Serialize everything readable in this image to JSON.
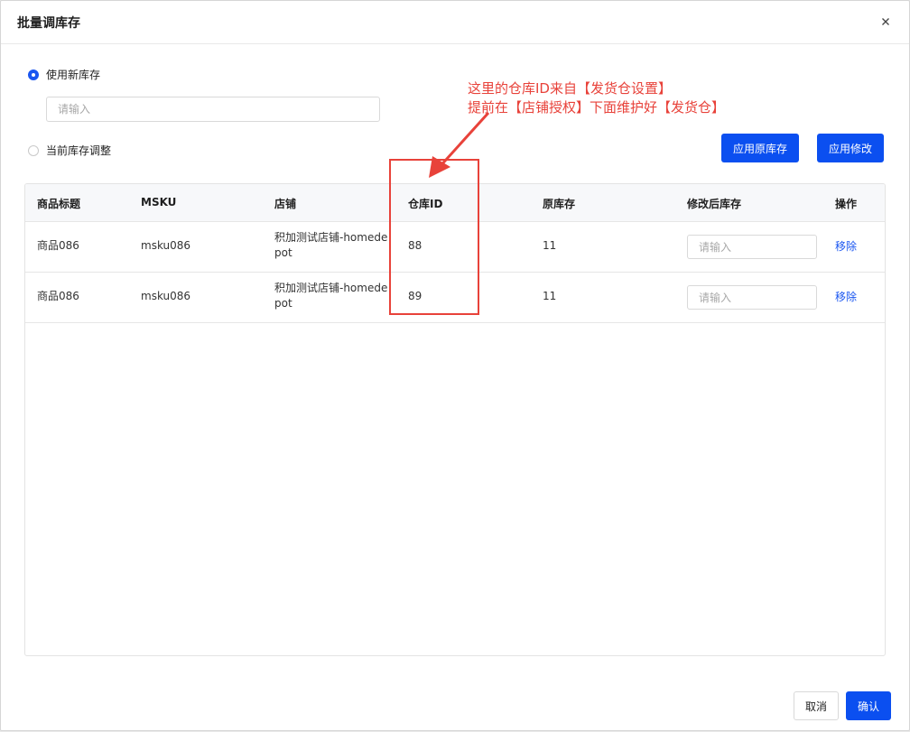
{
  "dialog": {
    "title": "批量调库存",
    "close_label": "×"
  },
  "mode": {
    "new_stock_label": "使用新库存",
    "new_stock_placeholder": "请输入",
    "current_adjust_label": "当前库存调整"
  },
  "buttons": {
    "apply_original": "应用原库存",
    "apply_changes": "应用修改",
    "cancel": "取消",
    "confirm": "确认"
  },
  "annotation": {
    "line1": "这里的仓库ID来自【发货仓设置】",
    "line2": "提前在【店铺授权】下面维护好【发货仓】"
  },
  "table": {
    "columns": [
      "商品标题",
      "MSKU",
      "店铺",
      "仓库ID",
      "原库存",
      "修改后库存",
      "操作"
    ],
    "rows": [
      {
        "title": "商品086",
        "msku": "msku086",
        "store": "积加测试店铺-homedepot",
        "warehouse_id": "88",
        "original_stock": "11",
        "new_stock_placeholder": "请输入",
        "action": "移除"
      },
      {
        "title": "商品086",
        "msku": "msku086",
        "store": "积加测试店铺-homedepot",
        "warehouse_id": "89",
        "original_stock": "11",
        "new_stock_placeholder": "请输入",
        "action": "移除"
      }
    ]
  },
  "colors": {
    "primary": "#0b4ff0",
    "link": "#1a56f0",
    "annotation": "#e8423a"
  }
}
